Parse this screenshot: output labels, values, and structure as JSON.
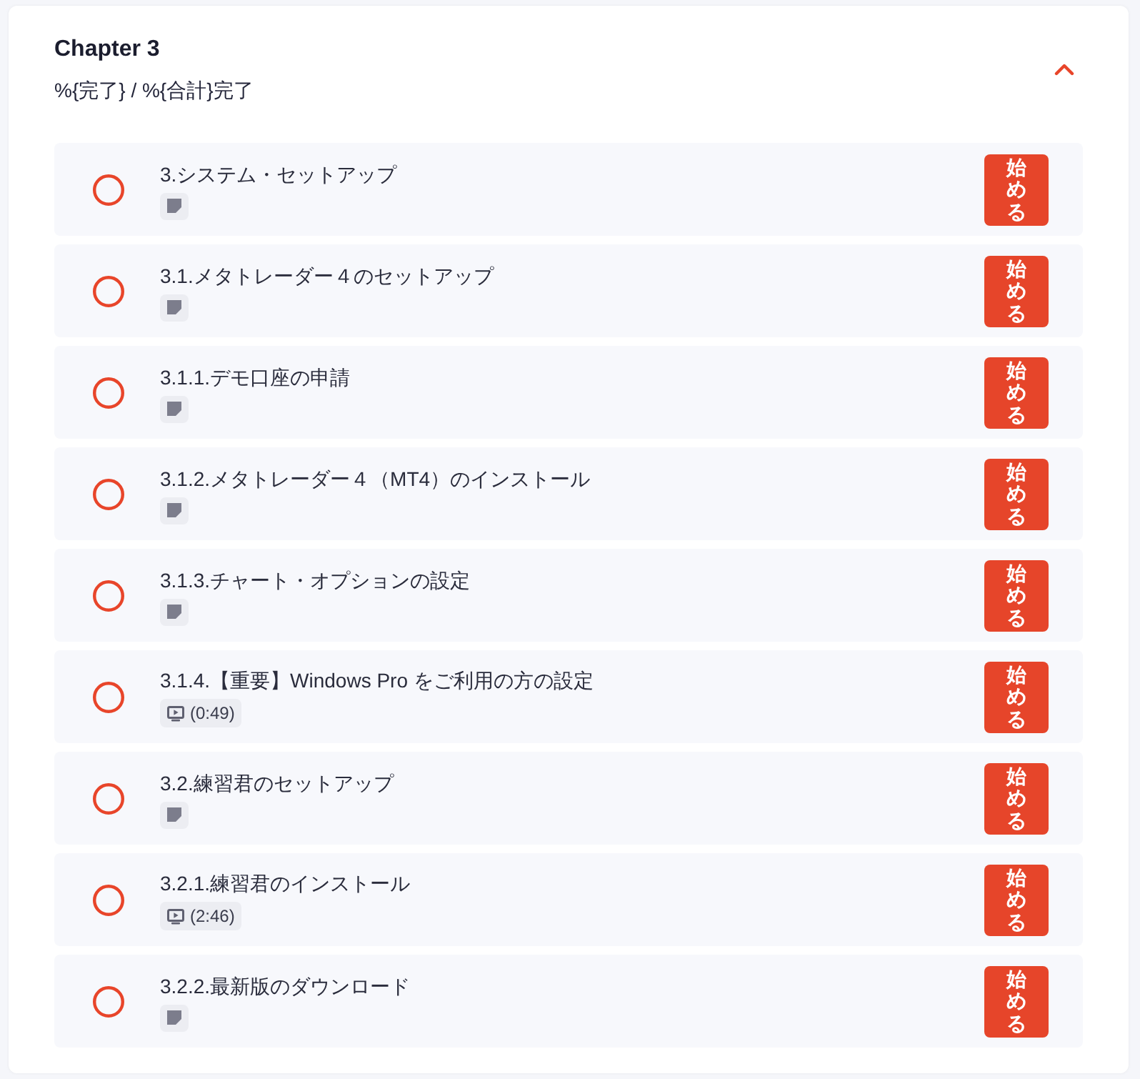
{
  "chapter": {
    "title": "Chapter 3",
    "progress": "%{完了} / %{合計}完了",
    "expanded": true
  },
  "lessons": [
    {
      "title": "3.システム・セットアップ",
      "completed": false,
      "kind": "text",
      "button": "始める"
    },
    {
      "title": "3.1.メタトレーダー４のセットアップ",
      "completed": false,
      "kind": "text",
      "button": "始める"
    },
    {
      "title": "3.1.1.デモ口座の申請",
      "completed": false,
      "kind": "text",
      "button": "始める"
    },
    {
      "title": "3.1.2.メタトレーダー４（MT4）のインストール",
      "completed": false,
      "kind": "text",
      "button": "始める"
    },
    {
      "title": "3.1.3.チャート・オプションの設定",
      "completed": false,
      "kind": "text",
      "button": "始める"
    },
    {
      "title": "3.1.4.【重要】Windows Pro をご利用の方の設定",
      "completed": false,
      "kind": "video",
      "duration": "(0:49)",
      "button": "始める"
    },
    {
      "title": "3.2.練習君のセットアップ",
      "completed": false,
      "kind": "text",
      "button": "始める"
    },
    {
      "title": "3.2.1.練習君のインストール",
      "completed": false,
      "kind": "video",
      "duration": "(2:46)",
      "button": "始める"
    },
    {
      "title": "3.2.2.最新版のダウンロード",
      "completed": false,
      "kind": "text",
      "button": "始める"
    }
  ]
}
